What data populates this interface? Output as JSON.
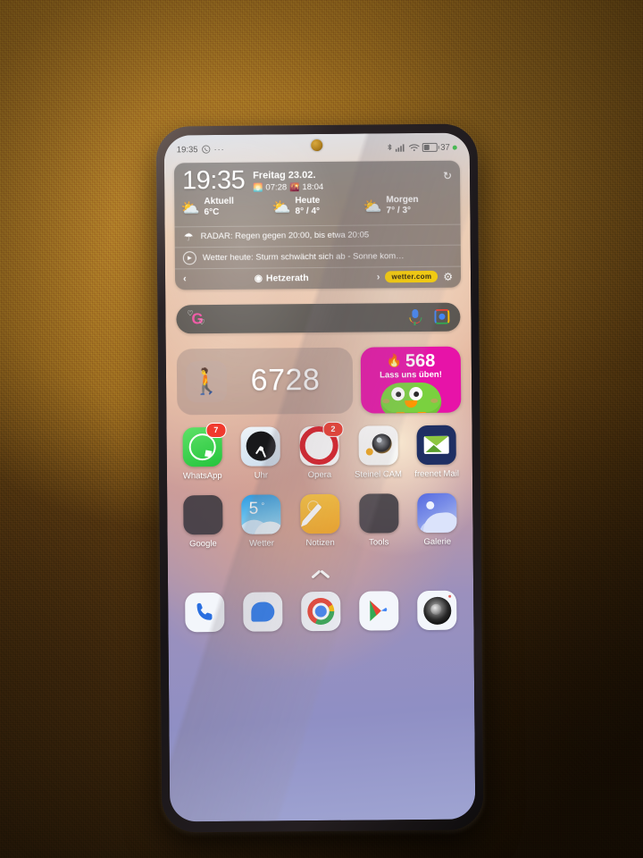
{
  "status_bar": {
    "time": "19:35",
    "whatsapp_icon": "whatsapp-icon",
    "more_dots": "···",
    "bluetooth_icon": "ᛦ",
    "signal_icon": "signal-bars-icon",
    "wifi_icon": "wifi-icon",
    "battery_percent": "37",
    "battery_icon": "battery-icon"
  },
  "weather_widget": {
    "time": "19:35",
    "date": "Freitag 23.02.",
    "sunrise_icon": "🌅",
    "sunrise": "07:28",
    "sunset_icon": "🌇",
    "sunset": "18:04",
    "refresh_icon": "↻",
    "cells": [
      {
        "icon": "⛅",
        "label": "Aktuell",
        "value": "6°C"
      },
      {
        "icon": "⛅",
        "label": "Heute",
        "value": "8° / 4°"
      },
      {
        "icon": "⛅",
        "label": "Morgen",
        "value": "7° / 3°"
      }
    ],
    "radar_icon": "☂",
    "radar_text": "RADAR: Regen gegen 20:00, bis etwa 20:05",
    "video_icon": "▶",
    "video_text": "Wetter heute: Sturm schwächt sich ab - Sonne kom…",
    "prev_icon": "‹",
    "next_icon": "›",
    "location_pin": "◉",
    "location": "Hetzerath",
    "brand": "wetter.com",
    "settings_icon": "⚙"
  },
  "search_bar": {
    "logo": "G",
    "logo_name": "google-doodle-hearts-icon",
    "placeholder": "",
    "mic_icon": "microphone-icon",
    "lens_icon": "google-lens-icon"
  },
  "widgets": {
    "steps": {
      "icon": "🚶",
      "count": "6728"
    },
    "duolingo": {
      "flame_icon": "🔥",
      "streak": "568",
      "subtitle": "Lass uns üben!",
      "mascot": "duo-owl-icon"
    }
  },
  "app_rows": [
    [
      {
        "label": "WhatsApp",
        "badge": "7",
        "icon": "whatsapp-icon"
      },
      {
        "label": "Uhr",
        "badge": "",
        "icon": "clock-icon"
      },
      {
        "label": "Opera",
        "badge": "2",
        "icon": "opera-icon"
      },
      {
        "label": "Steinel CAM",
        "badge": "",
        "icon": "steinel-cam-icon"
      },
      {
        "label": "freenet Mail",
        "badge": "",
        "icon": "freenet-mail-icon"
      }
    ],
    [
      {
        "label": "Google",
        "badge": "",
        "icon": "google-folder-icon"
      },
      {
        "label": "Wetter",
        "badge": "",
        "icon": "weather-icon",
        "temp": "5"
      },
      {
        "label": "Notizen",
        "badge": "",
        "icon": "notes-icon"
      },
      {
        "label": "Tools",
        "badge": "",
        "icon": "tools-folder-icon"
      },
      {
        "label": "Galerie",
        "badge": "",
        "icon": "gallery-icon"
      }
    ]
  ],
  "drawer_indicator": "app-drawer-chevron-up-icon",
  "dock": [
    {
      "name": "phone-icon",
      "glyph": "📞"
    },
    {
      "name": "messages-icon",
      "glyph": ""
    },
    {
      "name": "chrome-icon",
      "glyph": ""
    },
    {
      "name": "play-store-icon",
      "glyph": ""
    },
    {
      "name": "camera-icon",
      "glyph": ""
    }
  ],
  "colors": {
    "duolingo_pink": "#e713a8",
    "badge_red": "#f03a2e",
    "brand_yellow": "#ffd400",
    "whatsapp_green": "#24c43c",
    "opera_red": "#dd1a24"
  }
}
